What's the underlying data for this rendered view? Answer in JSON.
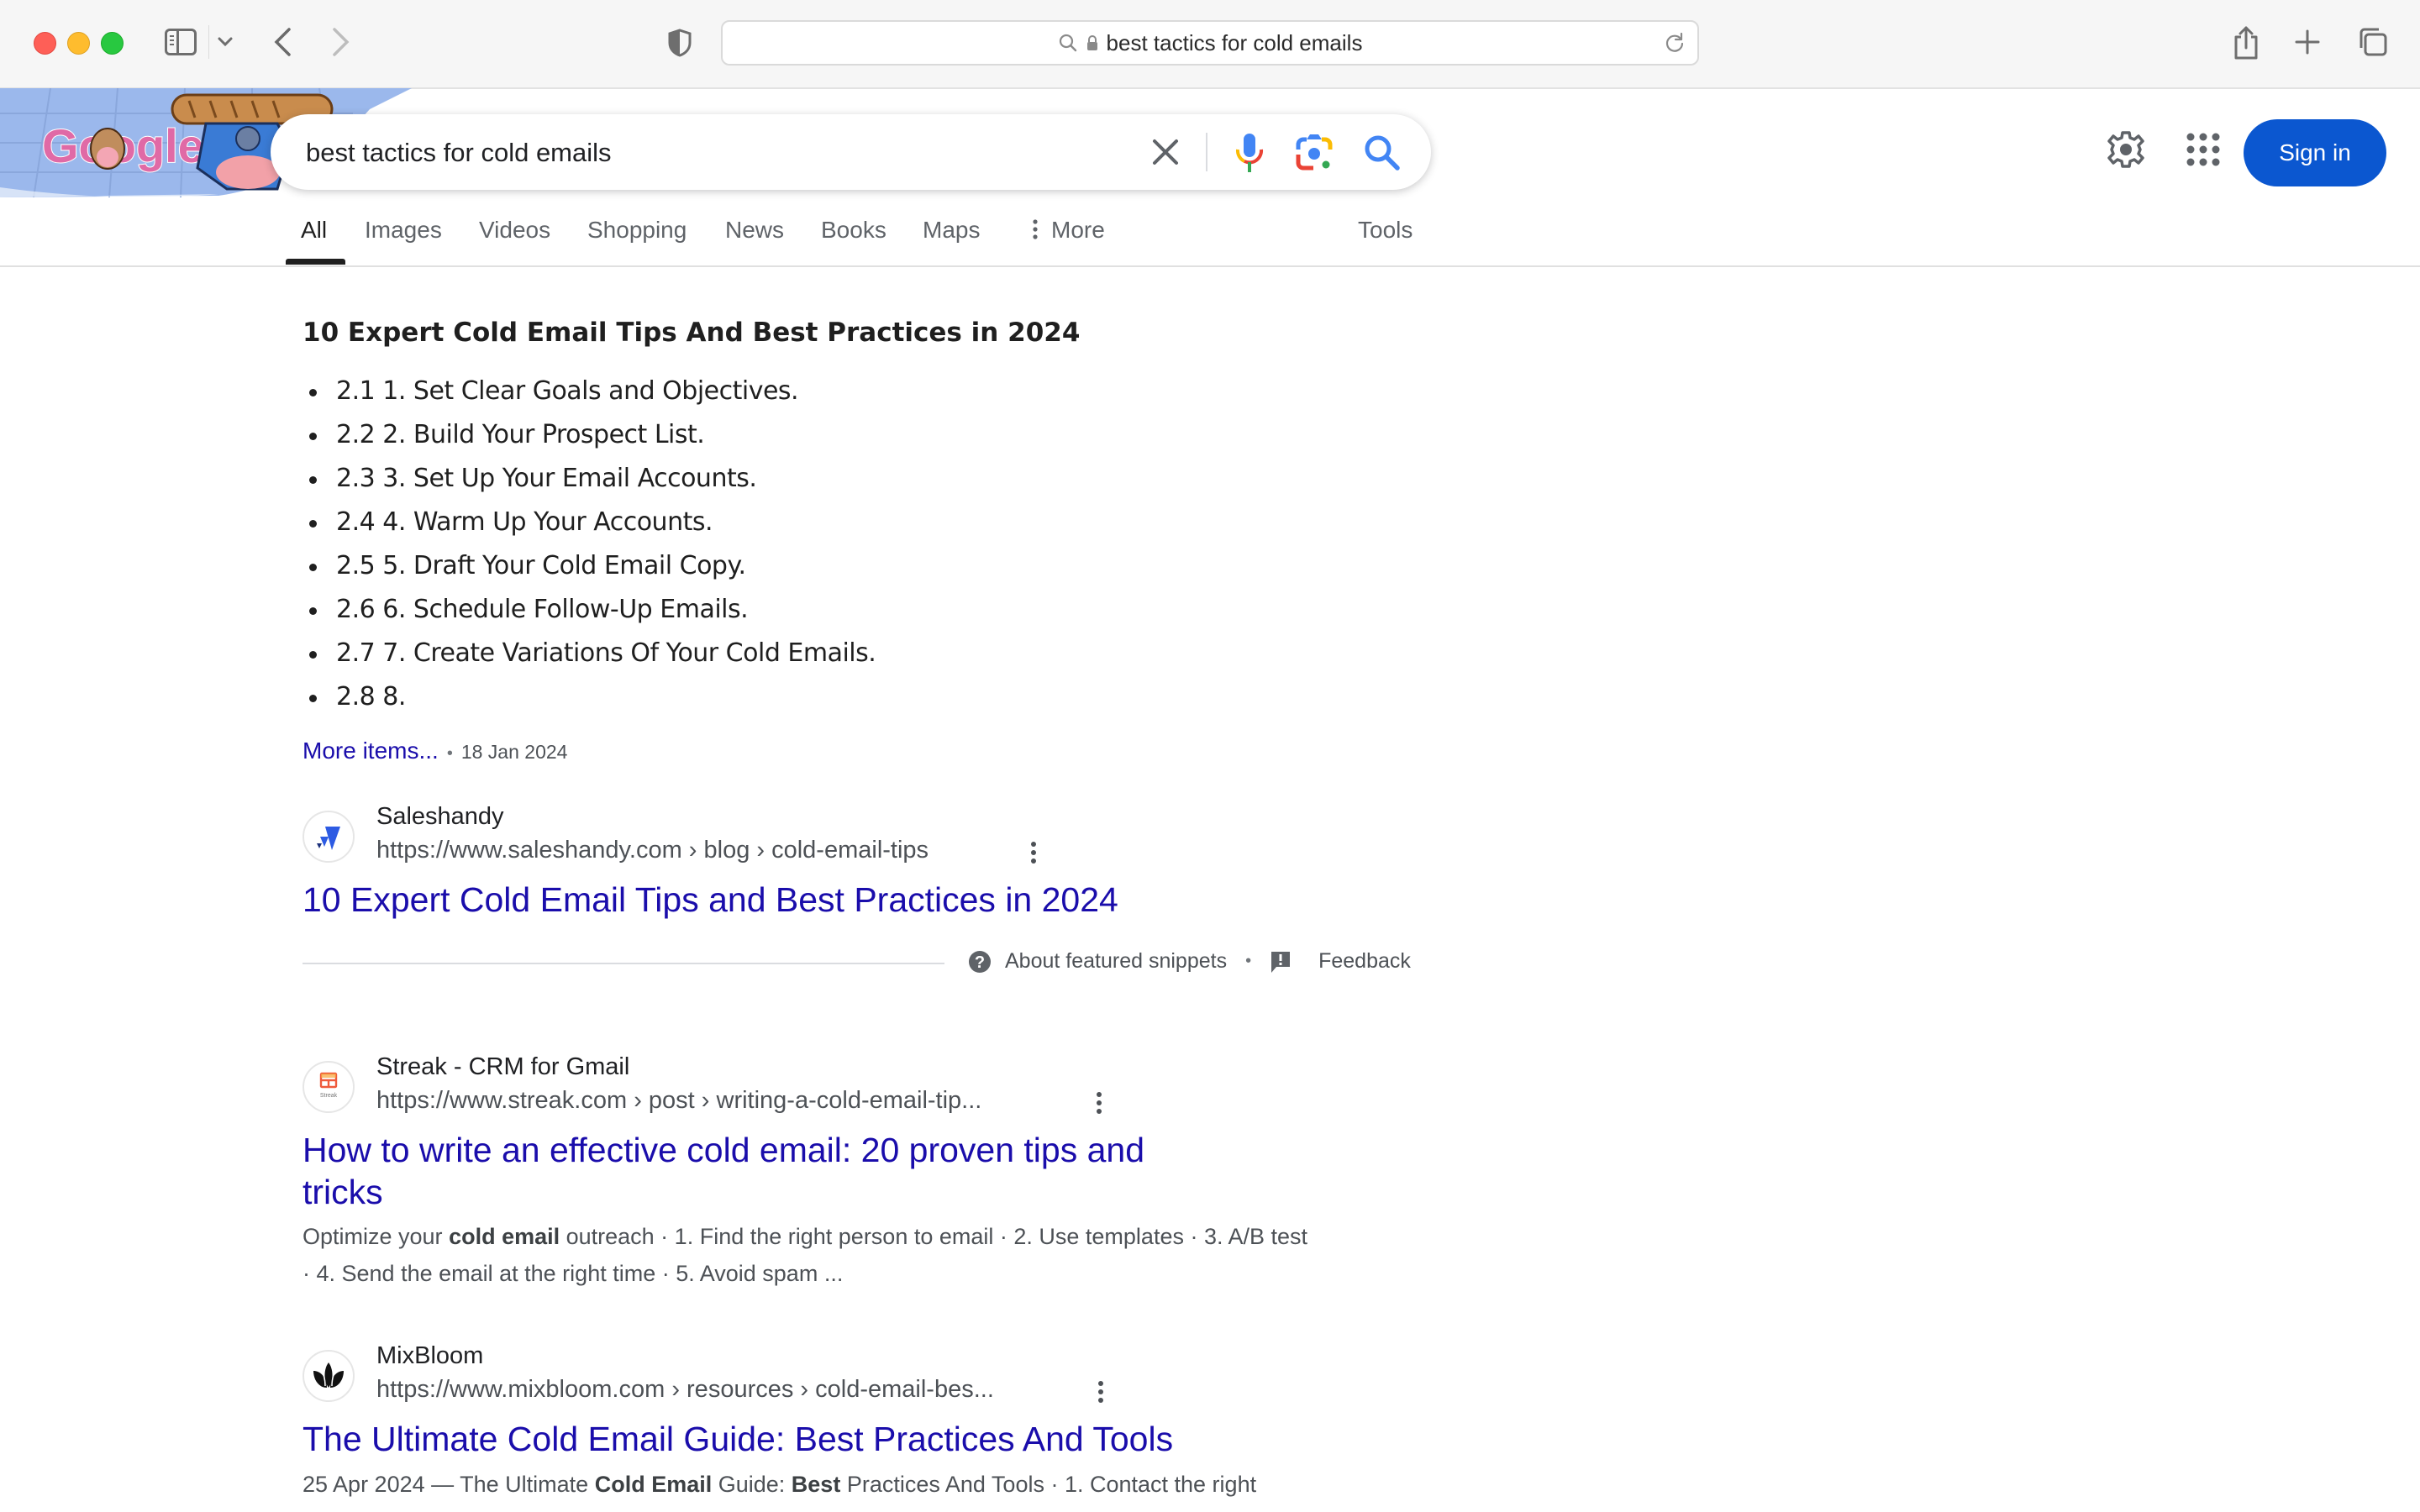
{
  "browser": {
    "address_bar_text": "best tactics for cold emails",
    "icons": {
      "sidebar": "sidebar-icon",
      "back": "chevron-left-icon",
      "forward": "chevron-right-icon",
      "privacy": "shield-icon",
      "search": "magnifier-icon",
      "lock": "lock-icon",
      "reload": "reload-icon",
      "share": "share-icon",
      "new_tab": "plus-icon",
      "tab_overview": "tabs-icon"
    },
    "back_glyph": "‹",
    "forward_glyph": "›",
    "chevron_glyph": "⌄",
    "new_tab_glyph": "+"
  },
  "google": {
    "logo_text": "Google",
    "search_query": "best tactics for cold emails",
    "sign_in_label": "Sign in",
    "colors": {
      "accent_blue": "#0b57d0",
      "link": "#1a0dab",
      "mic_blue": "#4285f4",
      "red": "#ea4335",
      "yellow": "#fbbc04",
      "green": "#34a853"
    }
  },
  "tabs": [
    {
      "label": "All",
      "active": true
    },
    {
      "label": "Images",
      "active": false
    },
    {
      "label": "Videos",
      "active": false
    },
    {
      "label": "Shopping",
      "active": false
    },
    {
      "label": "News",
      "active": false
    },
    {
      "label": "Books",
      "active": false
    },
    {
      "label": "Maps",
      "active": false
    },
    {
      "label": "More",
      "active": false
    }
  ],
  "tools_label": "Tools",
  "featured_snippet": {
    "heading": "10 Expert Cold Email Tips And Best Practices in 2024",
    "items": [
      "2.1 1. Set Clear Goals and Objectives.",
      "2.2 2. Build Your Prospect List.",
      "2.3 3. Set Up Your Email Accounts.",
      "2.4 4. Warm Up Your Accounts.",
      "2.5 5. Draft Your Cold Email Copy.",
      "2.6 6. Schedule Follow-Up Emails.",
      "2.7 7. Create Variations Of Your Cold Emails.",
      "2.8 8."
    ],
    "more_items_label": "More items...",
    "date": "18 Jan 2024",
    "source": {
      "site_name": "Saleshandy",
      "url": "https://www.saleshandy.com › blog › cold-email-tips",
      "title": "10 Expert Cold Email Tips and Best Practices in 2024"
    },
    "about_label": "About featured snippets",
    "feedback_label": "Feedback",
    "separator": "•"
  },
  "results": [
    {
      "site_name": "Streak - CRM for Gmail",
      "url": "https://www.streak.com › post › writing-a-cold-email-tip...",
      "title_line1": "How to write an effective cold email: 20 proven tips and",
      "title_line2": "tricks",
      "desc": [
        {
          "text": "Optimize your ",
          "bold": false
        },
        {
          "text": "cold email",
          "bold": true
        },
        {
          "text": " outreach · 1. Find the right person to email · 2. Use templates · 3. A/B test · 4. Send the email at the right time · 5. Avoid spam ...",
          "bold": false
        }
      ],
      "favicon_label": "Streak"
    },
    {
      "site_name": "MixBloom",
      "url": "https://www.mixbloom.com › resources › cold-email-bes...",
      "title_line1": "The Ultimate Cold Email Guide: Best Practices And Tools",
      "desc": [
        {
          "text": "25 Apr 2024 — The Ultimate ",
          "bold": false
        },
        {
          "text": "Cold Email",
          "bold": true
        },
        {
          "text": " Guide: ",
          "bold": false
        },
        {
          "text": "Best",
          "bold": true
        },
        {
          "text": " Practices And Tools · 1. Contact the right",
          "bold": false
        }
      ]
    }
  ]
}
